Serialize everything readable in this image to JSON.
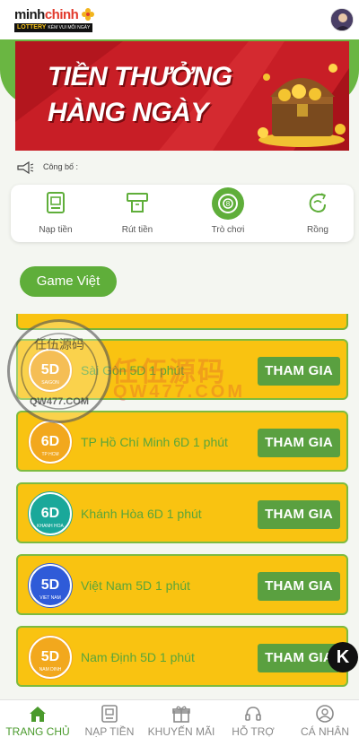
{
  "header": {
    "logo_main_dark": "minh",
    "logo_main_accent": "chinh",
    "logo_sub": "LOTTERY",
    "logo_tagline": "KÈM VUI MỖI NGÀY"
  },
  "banner": {
    "line1": "TIỀN THƯỞNG",
    "line2": "HÀNG NGÀY"
  },
  "notice": {
    "label": "Công bố :"
  },
  "quick_actions": [
    {
      "label": "Nạp tiền",
      "icon": "atm-deposit-icon"
    },
    {
      "label": "Rút tiền",
      "icon": "atm-withdraw-icon"
    },
    {
      "label": "Trò chơi",
      "icon": "game-ball-icon",
      "active": true
    },
    {
      "label": "Rồng",
      "icon": "dragon-icon"
    }
  ],
  "game_tab": {
    "label": "Game Việt"
  },
  "games": [
    {
      "title": "Sài Gòn 5D 1 phút",
      "badge_text": "5D",
      "badge_sub": "SAIGON",
      "badge_color": "#f2a81d",
      "button": "THAM GIA"
    },
    {
      "title": "TP Hồ Chí Minh 6D 1 phút",
      "badge_text": "6D",
      "badge_sub": "TP HCM",
      "badge_color": "#f2a81d",
      "button": "THAM GIA"
    },
    {
      "title": "Khánh Hòa 6D 1 phút",
      "badge_text": "6D",
      "badge_sub": "KHANH HOA",
      "badge_color": "#1aa89a",
      "button": "THAM GIA"
    },
    {
      "title": "Việt Nam 5D 1 phút",
      "badge_text": "5D",
      "badge_sub": "VIET NAM",
      "badge_color": "#2f5bd8",
      "button": "THAM GIA"
    },
    {
      "title": "Nam Định 5D 1 phút",
      "badge_text": "5D",
      "badge_sub": "NAM DINH",
      "badge_color": "#f2a81d",
      "button": "THAM GIA"
    }
  ],
  "watermark": {
    "ring_text": "任伍源码",
    "ring_url": "QW477.COM",
    "title": "任伍源码",
    "sub": "QW477.COM"
  },
  "floating": {
    "label": "K"
  },
  "bottom_nav": [
    {
      "label": "TRANG CHỦ",
      "icon": "home-icon",
      "active": true
    },
    {
      "label": "NẠP TIỀN",
      "icon": "deposit-icon"
    },
    {
      "label": "KHUYẾN MÃI",
      "icon": "gift-icon"
    },
    {
      "label": "HỖ TRỢ",
      "icon": "headset-icon"
    },
    {
      "label": "CÁ NHÂN",
      "icon": "user-icon"
    }
  ],
  "colors": {
    "brand_green": "#5fae3a",
    "card_yellow": "#f9c311",
    "banner_red": "#c81e26"
  }
}
